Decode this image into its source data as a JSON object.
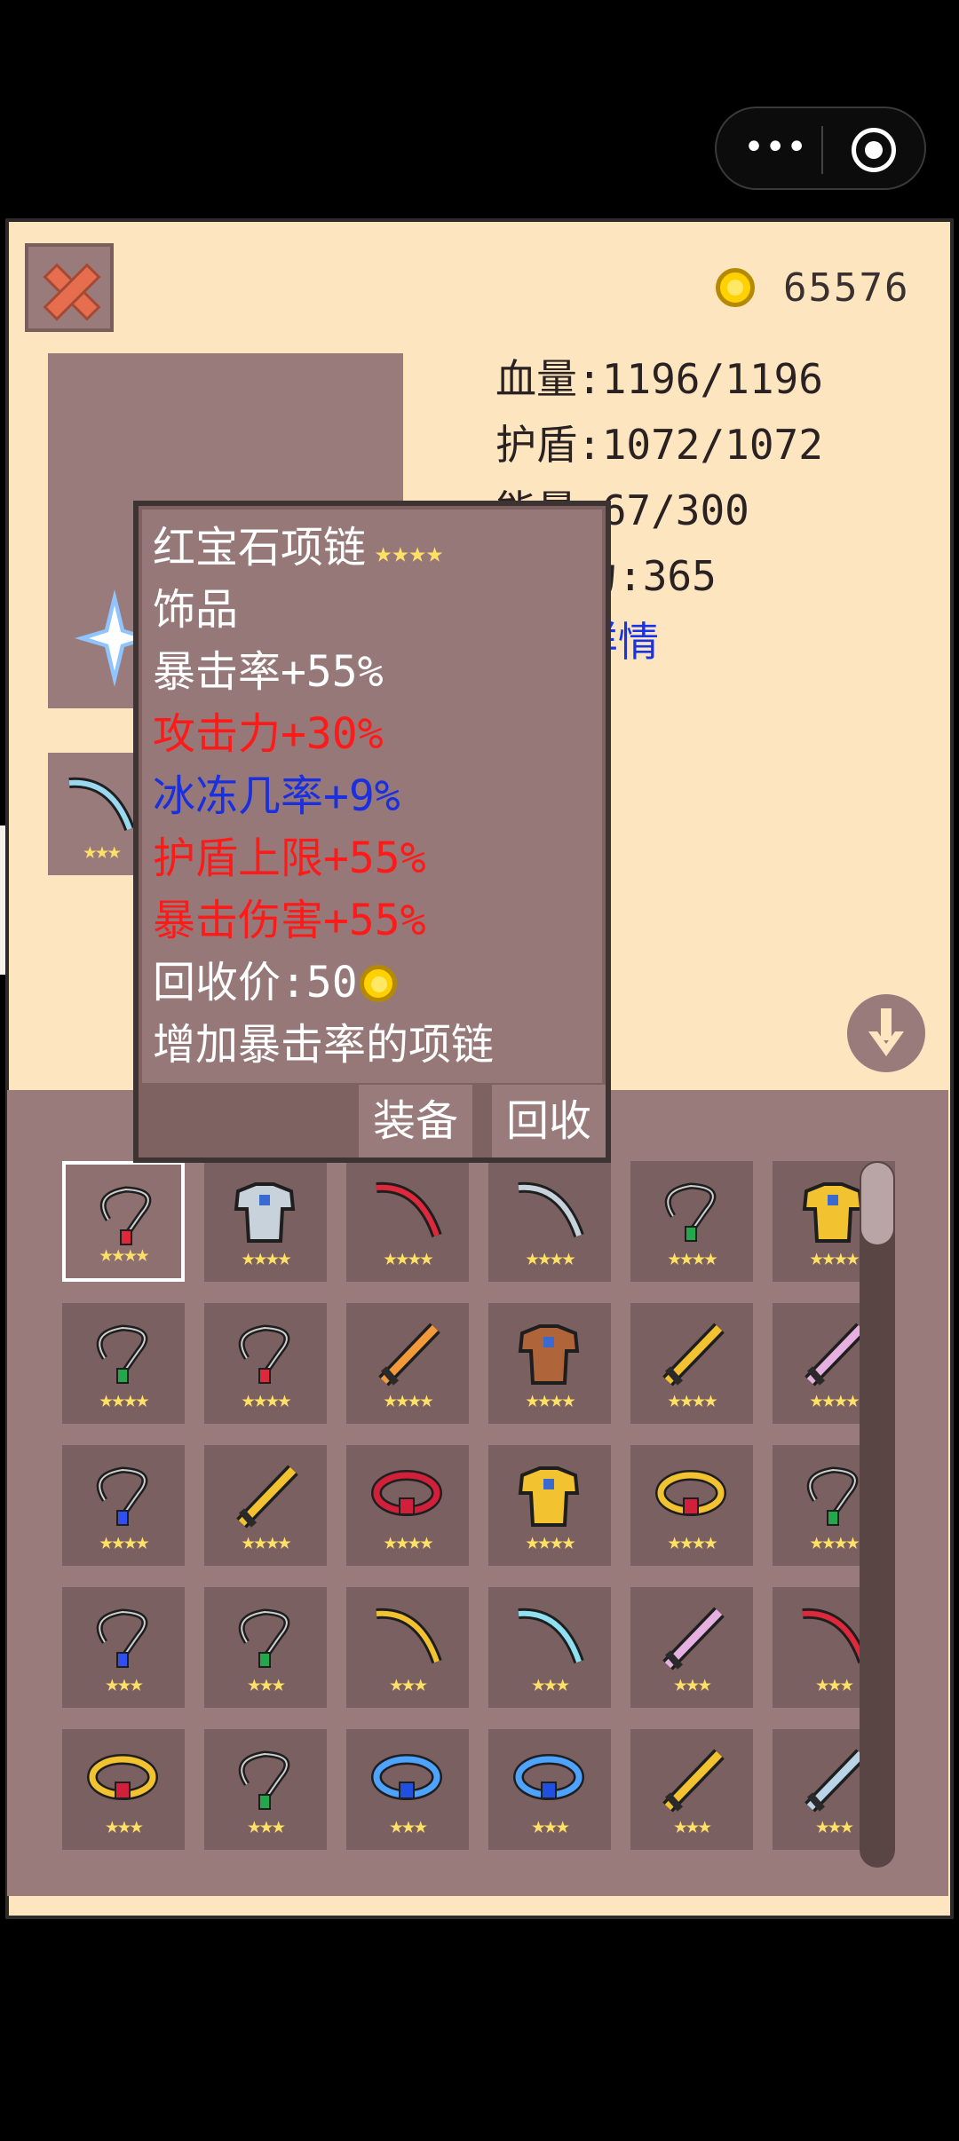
{
  "top_capsule": {
    "more_icon": "more-dots-icon",
    "close_icon": "target-circle-icon"
  },
  "header": {
    "gold_amount": "65576",
    "close_icon": "close-x-icon",
    "coin_icon": "gold-coin-icon"
  },
  "stats": {
    "hp": "血量:1196/1196",
    "shield": "护盾:1072/1072",
    "energy": "能量:67/300",
    "attack": "攻击力:365",
    "details_link": "属性详情",
    "fragment": "力"
  },
  "tooltip": {
    "name": "红宝石项链",
    "stars": "★★★★",
    "category": "饰品",
    "crit_rate": "暴击率+55%",
    "attack_bonus": "攻击力+30%",
    "freeze_chance": "冰冻几率+9%",
    "shield_max": "护盾上限+55%",
    "crit_damage": "暴击伤害+55%",
    "recycle_price": "回收价:50",
    "description": "增加暴击率的项链",
    "equip_label": "装备",
    "recycle_label": "回收"
  },
  "colors": {
    "panel": "#fde5c0",
    "slot": "#7a6060",
    "inventory": "#9a7b7b",
    "red_stat": "#ff1a1a",
    "blue_stat": "#1a2fe0"
  },
  "equipped_slot": {
    "item": "bow",
    "stars": "★★★"
  },
  "inventory": [
    {
      "item": "red-necklace",
      "stars": "★★★★",
      "selected": true
    },
    {
      "item": "silver-armor",
      "stars": "★★★★"
    },
    {
      "item": "red-bow",
      "stars": "★★★★"
    },
    {
      "item": "silver-bow",
      "stars": "★★★★"
    },
    {
      "item": "green-necklace",
      "stars": "★★★★"
    },
    {
      "item": "gold-armor",
      "stars": "★★★★"
    },
    {
      "item": "green-necklace",
      "stars": "★★★★"
    },
    {
      "item": "red-necklace",
      "stars": "★★★★"
    },
    {
      "item": "flame-sword",
      "stars": "★★★★"
    },
    {
      "item": "bronze-armor",
      "stars": "★★★★"
    },
    {
      "item": "gold-sword",
      "stars": "★★★★"
    },
    {
      "item": "pink-sword",
      "stars": "★★★★"
    },
    {
      "item": "blue-necklace",
      "stars": "★★★★"
    },
    {
      "item": "gold-dagger",
      "stars": "★★★★"
    },
    {
      "item": "ruby-ring",
      "stars": "★★★★"
    },
    {
      "item": "gold-armor",
      "stars": "★★★★"
    },
    {
      "item": "ruby-ring-gold",
      "stars": "★★★★"
    },
    {
      "item": "green-necklace",
      "stars": "★★★★"
    },
    {
      "item": "blue-necklace",
      "stars": "★★★"
    },
    {
      "item": "green-necklace",
      "stars": "★★★"
    },
    {
      "item": "gold-bow",
      "stars": "★★★"
    },
    {
      "item": "cyan-bow",
      "stars": "★★★"
    },
    {
      "item": "pink-sword",
      "stars": "★★★"
    },
    {
      "item": "red-bow",
      "stars": "★★★"
    },
    {
      "item": "ruby-ring-gold",
      "stars": "★★★"
    },
    {
      "item": "green-necklace",
      "stars": "★★★"
    },
    {
      "item": "sapphire-ring",
      "stars": "★★★"
    },
    {
      "item": "sapphire-ring",
      "stars": "★★★"
    },
    {
      "item": "gold-sword",
      "stars": "★★★"
    },
    {
      "item": "steel-sword",
      "stars": "★★★"
    }
  ]
}
